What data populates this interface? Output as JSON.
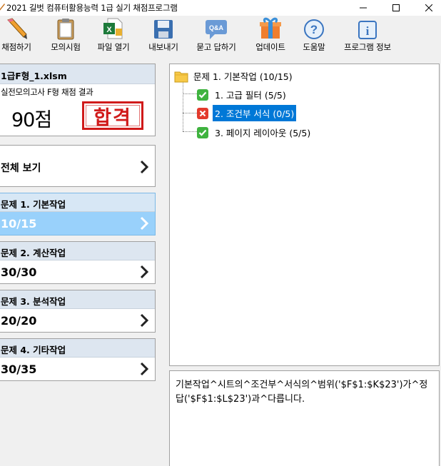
{
  "window": {
    "title": "2021 길벗 컴퓨터활용능력 1급 실기 채점프로그램"
  },
  "toolbar": {
    "items": [
      {
        "label": "채점하기",
        "icon": "pencil-icon"
      },
      {
        "label": "모의시험",
        "icon": "clipboard-icon"
      },
      {
        "label": "파일 열기",
        "icon": "excel-file-icon"
      },
      {
        "label": "내보내기",
        "icon": "floppy-disk-icon"
      },
      {
        "label": "묻고 답하기",
        "icon": "qna-bubble-icon"
      },
      {
        "label": "업데이트",
        "icon": "gift-box-icon"
      },
      {
        "label": "도움말",
        "icon": "question-circle-icon"
      },
      {
        "label": "프로그램 정보",
        "icon": "info-icon"
      }
    ]
  },
  "result": {
    "filename": "1급F형_1.xlsm",
    "subtitle": "실전모의고사 F형 채점 결과",
    "score": "90점",
    "stamp": "합격",
    "stamp_color": "#d01a1a"
  },
  "overall": {
    "label": "전체 보기"
  },
  "questions": [
    {
      "title": "문제 1. 기본작업",
      "score": "10/15",
      "active": true
    },
    {
      "title": "문제 2. 계산작업",
      "score": "30/30",
      "active": false
    },
    {
      "title": "문제 3. 분석작업",
      "score": "20/20",
      "active": false
    },
    {
      "title": "문제 4. 기타작업",
      "score": "30/35",
      "active": false
    }
  ],
  "tree": {
    "root": {
      "label": "문제 1. 기본작업 (10/15)",
      "icon": "folder-icon"
    },
    "children": [
      {
        "label": "1. 고급 필터 (5/5)",
        "status": "correct"
      },
      {
        "label": "2. 조건부 서식 (0/5)",
        "status": "wrong",
        "selected": true
      },
      {
        "label": "3. 페이지 레이아웃 (5/5)",
        "status": "correct"
      }
    ]
  },
  "message": {
    "text": "기본작업^시트의^조건부^서식의^범위('$F$1:$K$23')가^정답('$F$1:$L$23')과^다릅니다."
  },
  "colors": {
    "active_question_bg": "#99d1fb",
    "header_bg": "#dde6f0",
    "selection": "#0078d7",
    "correct": "#3fb33f",
    "wrong": "#e33a2c"
  }
}
